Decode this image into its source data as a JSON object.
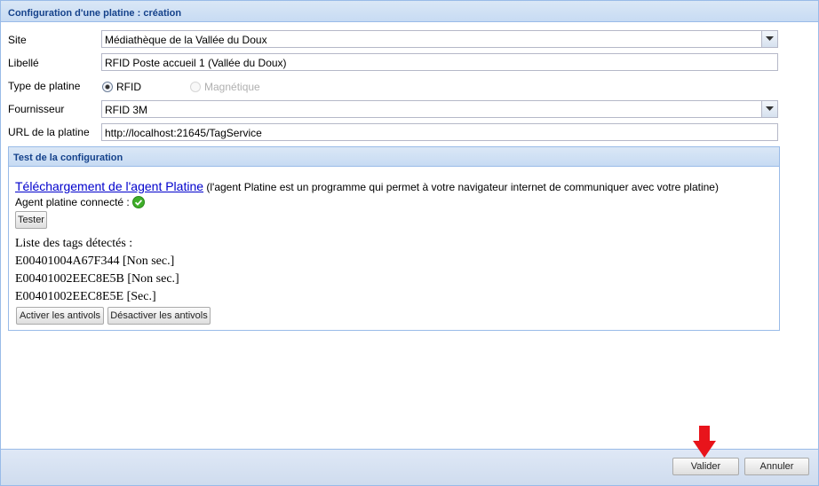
{
  "header": {
    "title": "Configuration d'une platine : création"
  },
  "form": {
    "site": {
      "label": "Site",
      "value": "Médiathèque de la Vallée du Doux"
    },
    "libelle": {
      "label": "Libellé",
      "value": "RFID Poste accueil 1 (Vallée du Doux)"
    },
    "type": {
      "label": "Type de platine",
      "option_rfid": "RFID",
      "option_magnetique": "Magnétique",
      "selected": "RFID"
    },
    "fournisseur": {
      "label": "Fournisseur",
      "value": "RFID 3M"
    },
    "url": {
      "label": "URL de la platine",
      "value": "http://localhost:21645/TagService"
    }
  },
  "test": {
    "title": "Test de la configuration",
    "download_link": "Téléchargement de l'agent Platine",
    "download_note": "(l'agent Platine est un programme qui permet à votre navigateur internet de communiquer avec votre platine)",
    "agent_status": "Agent platine connecté :",
    "tester_label": "Tester",
    "tags_title": "Liste des tags détectés :",
    "tags": [
      "E00401004A67F344 [Non sec.]",
      "E00401002EEC8E5B [Non sec.]",
      "E00401002EEC8E5E [Sec.]"
    ],
    "activate_label": "Activer les antivols",
    "deactivate_label": "Désactiver les antivols"
  },
  "footer": {
    "validate_label": "Valider",
    "cancel_label": "Annuler"
  },
  "colors": {
    "accent": "#15428b",
    "border": "#99bbe8",
    "arrow": "#e8141b",
    "check": "#3fae29"
  }
}
